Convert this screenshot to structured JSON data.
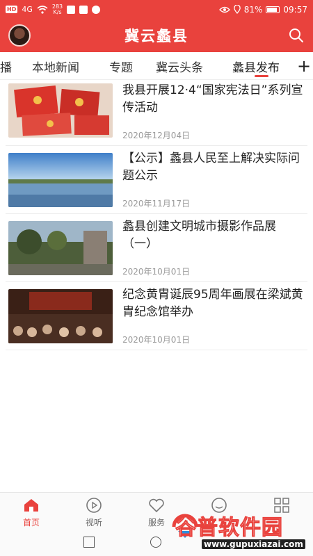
{
  "status_bar": {
    "network_badge": "HD",
    "network_type": "4G",
    "speed_value": "283",
    "speed_unit": "K/s",
    "battery": "81%",
    "time": "09:57"
  },
  "header": {
    "title": "冀云蠡县",
    "icons": [
      "avatar",
      "search-icon"
    ]
  },
  "tabs": [
    {
      "label": "播"
    },
    {
      "label": "本地新闻"
    },
    {
      "label": "专题"
    },
    {
      "label": "冀云头条"
    },
    {
      "label": "蠡县发布",
      "active": true
    }
  ],
  "tab_more_label": "+",
  "news": [
    {
      "title": "我县开展12·4“国家宪法日”系列宣传活动",
      "date": "2020年12月04日"
    },
    {
      "title": "【公示】蠡县人民至上解决实际问题公示",
      "date": "2020年11月17日"
    },
    {
      "title": "蠡县创建文明城市摄影作品展（一）",
      "date": "2020年10月01日"
    },
    {
      "title": "纪念黄胄诞辰95周年画展在梁斌黄胄纪念馆举办",
      "date": "2020年10月01日"
    }
  ],
  "bottom_nav": [
    {
      "label": "首页",
      "icon": "home-icon",
      "active": true
    },
    {
      "label": "视听",
      "icon": "play-icon"
    },
    {
      "label": "服务",
      "icon": "heart-icon"
    },
    {
      "label": "",
      "icon": "chat-icon"
    },
    {
      "label": "",
      "icon": "grid-icon"
    }
  ],
  "watermark": {
    "title": "谷普软件园",
    "url": "www.gupuxiazai.com"
  },
  "colors": {
    "brand": "#e9423d",
    "text": "#222222",
    "muted": "#9a9a9a"
  }
}
